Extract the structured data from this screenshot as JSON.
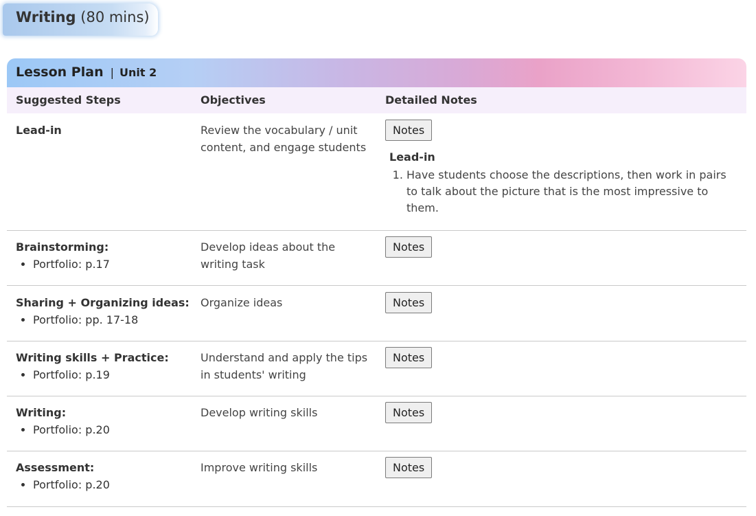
{
  "section": {
    "title": "Writing",
    "duration": "(80 mins)"
  },
  "lesson_plan": {
    "title": "Lesson Plan",
    "separator": "|",
    "unit": "Unit 2"
  },
  "columns": [
    "Suggested Steps",
    "Objectives",
    "Detailed Notes"
  ],
  "rows": [
    {
      "step": "Lead-in",
      "objective": "Review the vocabulary / unit content, and engage students",
      "notes_label": "Notes",
      "detail": {
        "title": "Lead-in",
        "items": [
          "Have students choose the descriptions, then work in pairs to talk about the picture that is the most impressive to them."
        ]
      }
    },
    {
      "step": "Brainstorming:",
      "sub": "Portfolio: p.17",
      "objective": "Develop ideas about the writing task",
      "notes_label": "Notes"
    },
    {
      "step": "Sharing + Organizing ideas:",
      "sub": "Portfolio: pp. 17-18",
      "objective": "Organize ideas",
      "notes_label": "Notes"
    },
    {
      "step": "Writing skills + Practice:",
      "sub": "Portfolio: p.19",
      "objective": "Understand and apply the tips in students' writing",
      "notes_label": "Notes"
    },
    {
      "step": "Writing:",
      "sub": "Portfolio: p.20",
      "objective": "Develop writing skills",
      "notes_label": "Notes"
    },
    {
      "step": "Assessment:",
      "sub": "Portfolio: p.20",
      "objective": "Improve writing skills",
      "notes_label": "Notes"
    }
  ]
}
